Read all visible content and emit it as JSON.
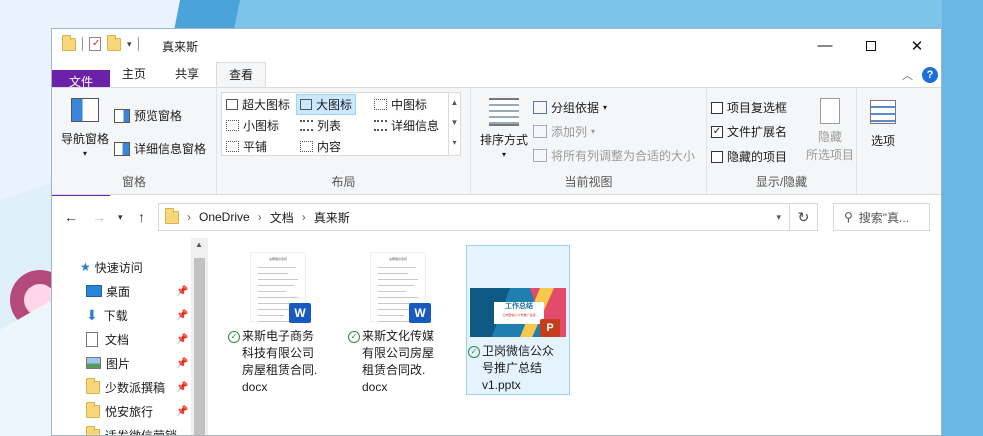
{
  "window": {
    "title": "真来斯"
  },
  "ribbon_tabs": [
    "文件",
    "主页",
    "共享",
    "查看"
  ],
  "ribbon": {
    "panes": {
      "label": "窗格",
      "nav_pane": "导航窗格",
      "preview_pane": "预览窗格",
      "details_pane": "详细信息窗格"
    },
    "layout": {
      "label": "布局",
      "items": [
        "超大图标",
        "大图标",
        "中图标",
        "小图标",
        "列表",
        "详细信息",
        "平铺",
        "内容"
      ],
      "selected": "大图标"
    },
    "current_view": {
      "label": "当前视图",
      "sort_by": "排序方式",
      "group_by": "分组依据",
      "add_column": "添加列",
      "fit_columns": "将所有列调整为合适的大小"
    },
    "show_hide": {
      "label": "显示/隐藏",
      "item_checkboxes": "项目复选框",
      "file_extensions": "文件扩展名",
      "hidden_items": "隐藏的项目",
      "hide_selected_line1": "隐藏",
      "hide_selected_line2": "所选项目",
      "options": "选项"
    },
    "checkbox_states": {
      "item_checkboxes": false,
      "file_extensions": true,
      "hidden_items": false
    }
  },
  "address": {
    "breadcrumb": [
      "OneDrive",
      "文档",
      "真来斯"
    ],
    "search_placeholder": "搜索\"真..."
  },
  "nav_pane": {
    "quick_access": "快速访问",
    "items": [
      "桌面",
      "下载",
      "文档",
      "图片",
      "少数派撰稿",
      "悦安旅行",
      "适发微信营销"
    ]
  },
  "files": [
    {
      "name_lines": [
        "来斯电子商务",
        "科技有限公司",
        "房屋租赁合同.",
        "docx"
      ],
      "type": "word",
      "thumb_title": "房屋租赁合同"
    },
    {
      "name_lines": [
        "来斯文化传媒",
        "有限公司房屋",
        "租赁合同改.",
        "docx"
      ],
      "type": "word",
      "thumb_title": "房屋租赁合同"
    },
    {
      "name_lines": [
        "卫岗微信公众",
        "号推广总结",
        "v1.pptx"
      ],
      "type": "pptx",
      "thumb_title": "工作总结",
      "thumb_sub": "卫岗微信公众号推广总结"
    }
  ],
  "colors": {
    "file_tab": "#6b21a8",
    "selected": "#cce8ff",
    "word": "#185abd",
    "ppt": "#c43e1c",
    "sync_ok": "#2e8b3d"
  }
}
